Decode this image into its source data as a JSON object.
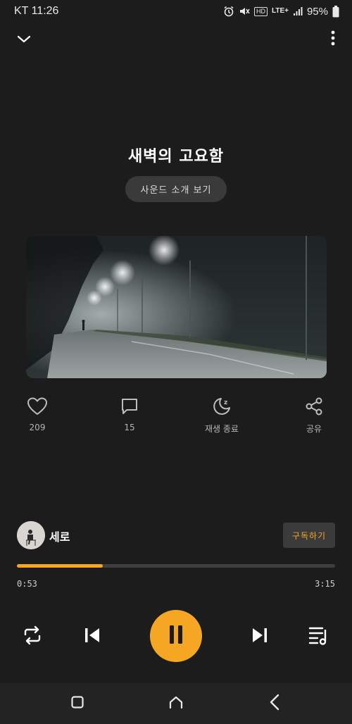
{
  "status_bar": {
    "carrier_time": "KT 11:26",
    "hd": "HD",
    "network": "LTE+",
    "battery": "95%",
    "icons": [
      "alarm-icon",
      "mute-icon",
      "signal-icon",
      "battery-icon"
    ]
  },
  "top_bar": {
    "icons": [
      "chevron-down-icon",
      "more-vertical-icon"
    ]
  },
  "track": {
    "title": "새벽의 고요함",
    "intro_button": "사운드 소개 보기"
  },
  "actions": {
    "like_count": "209",
    "comment_count": "15",
    "sleep_timer_label": "재생 종료",
    "share_label": "공유"
  },
  "artist": {
    "name": "세로",
    "subscribe_label": "구독하기"
  },
  "player": {
    "elapsed": "0:53",
    "total": "3:15",
    "progress_fraction": 0.27,
    "state": "playing"
  },
  "colors": {
    "accent": "#f5a623",
    "background": "#1c1c1c"
  },
  "nav_bar": {
    "icons": [
      "recents-icon",
      "home-icon",
      "back-icon"
    ]
  }
}
